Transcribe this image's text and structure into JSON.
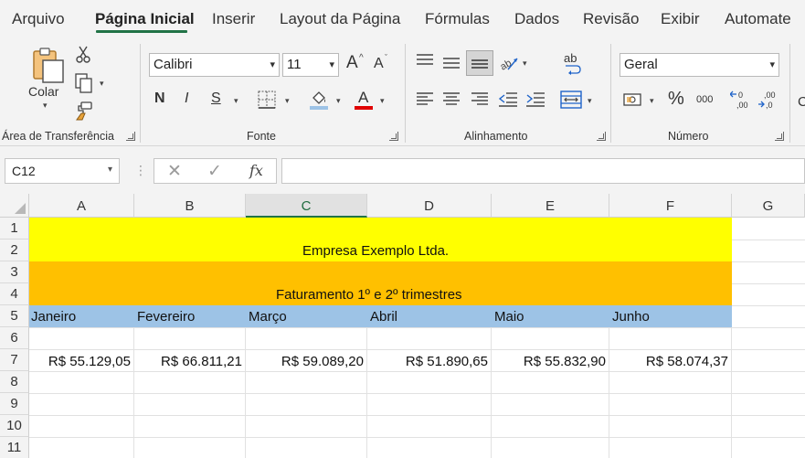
{
  "ribbon": {
    "tabs": [
      "Arquivo",
      "Página Inicial",
      "Inserir",
      "Layout da Página",
      "Fórmulas",
      "Dados",
      "Revisão",
      "Exibir",
      "Automate"
    ],
    "clipboard": {
      "paste_label": "Colar",
      "group_label": "Área de Transferência"
    },
    "font": {
      "family_value": "Calibri",
      "size_value": "11",
      "grow_label": "A",
      "shrink_label": "A",
      "bold_label": "N",
      "italic_label": "I",
      "underline_label": "S",
      "font_color_label": "A",
      "group_label": "Fonte"
    },
    "alignment": {
      "wrap_label": "ab",
      "group_label": "Alinhamento"
    },
    "number": {
      "format_value": "Geral",
      "percent_label": "%",
      "thousands_label": "000",
      "increase_decimal_label": "←0 ,00",
      "decrease_decimal_label": ",00 →0",
      "group_label": "Número"
    },
    "next_group_partial": "C"
  },
  "formula_bar": {
    "name_box": "C12",
    "fx_label": "fx",
    "formula": ""
  },
  "sheet": {
    "columns": [
      "A",
      "B",
      "C",
      "D",
      "E",
      "F",
      "G"
    ],
    "selected_column": "C",
    "rows": [
      "1",
      "2",
      "3",
      "4",
      "5",
      "6",
      "7",
      "8",
      "9",
      "10",
      "11"
    ],
    "title": "Empresa Exemplo Ltda.",
    "subtitle": "Faturamento 1º e 2º trimestres",
    "months": [
      "Janeiro",
      "Fevereiro",
      "Março",
      "Abril",
      "Maio",
      "Junho"
    ],
    "values": [
      "R$ 55.129,05",
      "R$ 66.811,21",
      "R$ 59.089,20",
      "R$ 51.890,65",
      "R$ 55.832,90",
      "R$ 58.074,37"
    ]
  },
  "colors": {
    "accent": "#217346",
    "title_fill": "#ffff00",
    "subtitle_fill": "#ffc000",
    "header_fill": "#9dc3e6"
  }
}
